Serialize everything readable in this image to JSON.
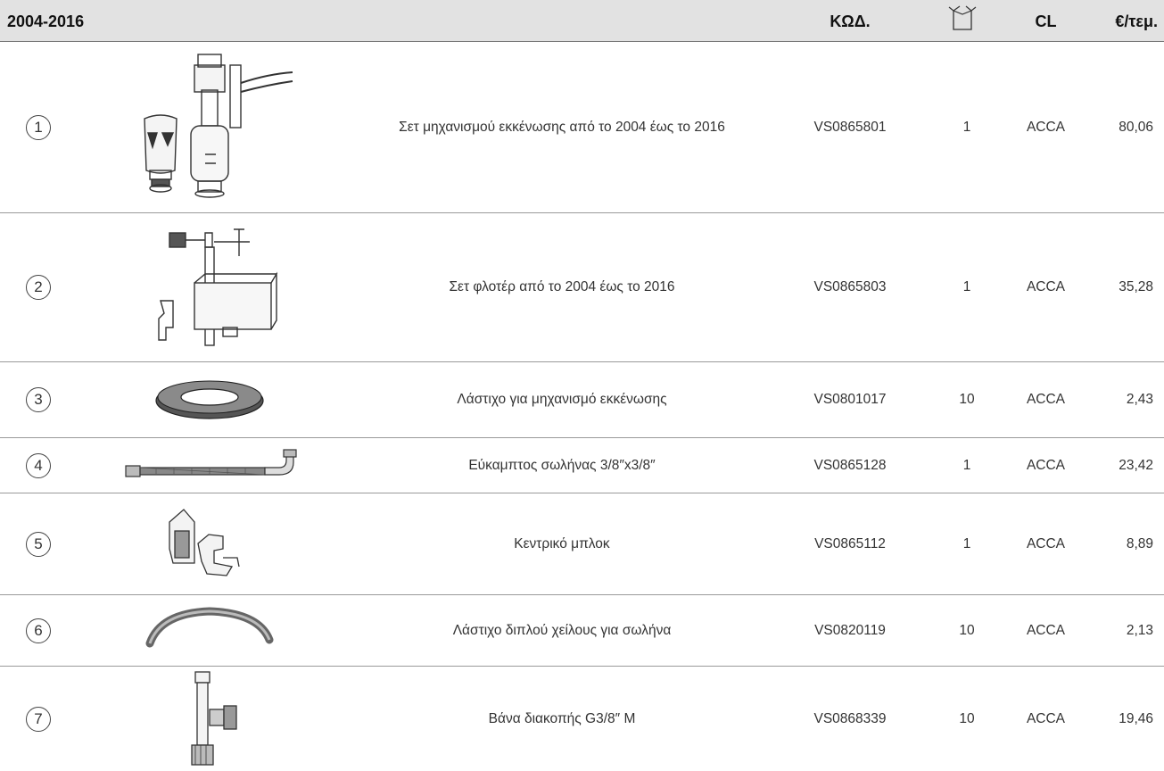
{
  "header": {
    "title": "2004-2016",
    "code_label": "ΚΩΔ.",
    "pack_icon": "box-icon",
    "cl_label": "CL",
    "price_label": "€/τεμ."
  },
  "rows": [
    {
      "num": "1",
      "desc": "Σετ μηχανισμού εκκένωσης από το 2004 έως το 2016",
      "code": "VS0865801",
      "qty": "1",
      "cl": "ACCA",
      "price": "80,06",
      "icon": "flush-mechanism-set-image"
    },
    {
      "num": "2",
      "desc": "Σετ φλοτέρ από το 2004 έως το 2016",
      "code": "VS0865803",
      "qty": "1",
      "cl": "ACCA",
      "price": "35,28",
      "icon": "float-valve-set-image"
    },
    {
      "num": "3",
      "desc": "Λάστιχο για μηχανισμό εκκένωσης",
      "code": "VS0801017",
      "qty": "10",
      "cl": "ACCA",
      "price": "2,43",
      "icon": "rubber-seal-ring-image"
    },
    {
      "num": "4",
      "desc": "Εύκαμπτος σωλήνας 3/8″x3/8″",
      "code": "VS0865128",
      "qty": "1",
      "cl": "ACCA",
      "price": "23,42",
      "icon": "flexible-hose-image"
    },
    {
      "num": "5",
      "desc": "Κεντρικό μπλοκ",
      "code": "VS0865112",
      "qty": "1",
      "cl": "ACCA",
      "price": "8,89",
      "icon": "central-block-image"
    },
    {
      "num": "6",
      "desc": "Λάστιχο διπλού χείλους για σωλήνα",
      "code": "VS0820119",
      "qty": "10",
      "cl": "ACCA",
      "price": "2,13",
      "icon": "double-lip-seal-image"
    },
    {
      "num": "7",
      "desc": "Βάνα διακοπής G3/8″ M",
      "code": "VS0868339",
      "qty": "10",
      "cl": "ACCA",
      "price": "19,46",
      "icon": "shutoff-valve-image"
    }
  ]
}
